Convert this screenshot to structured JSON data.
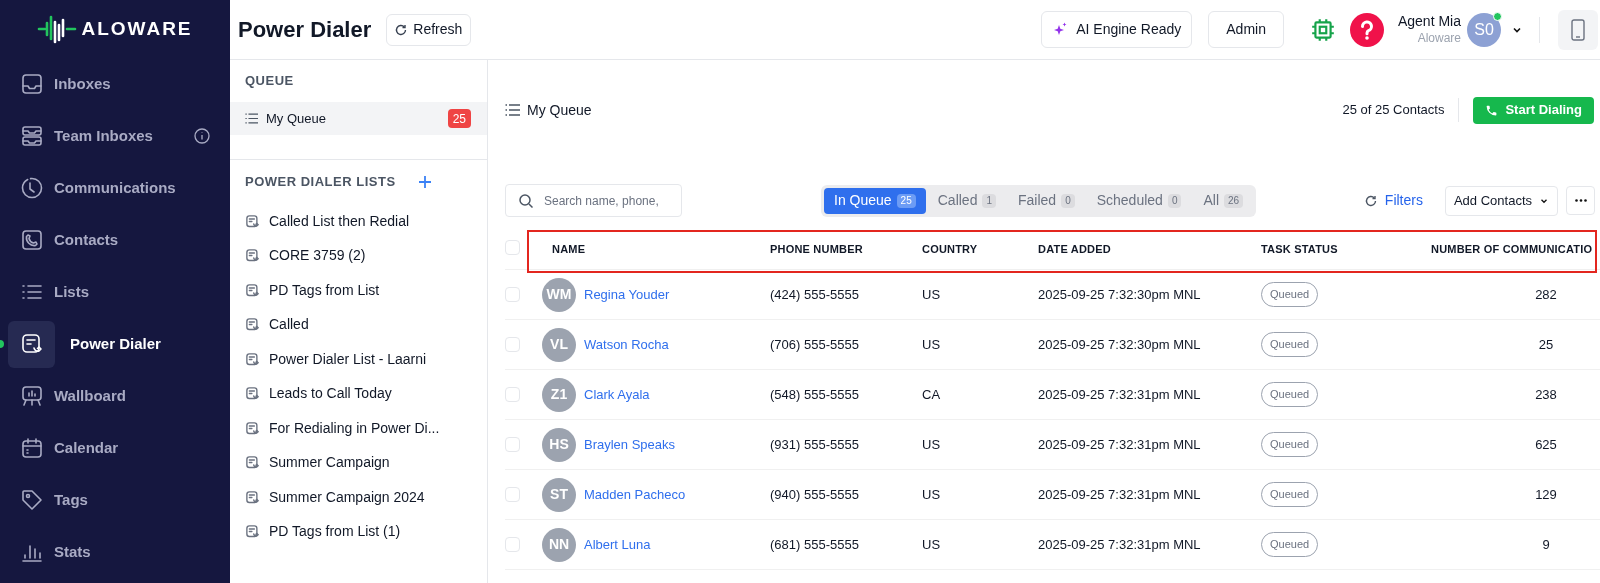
{
  "brand": {
    "name": "ALOWARE"
  },
  "sidebar": {
    "items": [
      {
        "label": "Inboxes",
        "selected": false,
        "info": false
      },
      {
        "label": "Team Inboxes",
        "selected": false,
        "info": true
      },
      {
        "label": "Communications",
        "selected": false,
        "info": false
      },
      {
        "label": "Contacts",
        "selected": false,
        "info": false
      },
      {
        "label": "Lists",
        "selected": false,
        "info": false
      },
      {
        "label": "Power Dialer",
        "selected": true,
        "info": false
      },
      {
        "label": "Wallboard",
        "selected": false,
        "info": false
      },
      {
        "label": "Calendar",
        "selected": false,
        "info": false
      },
      {
        "label": "Tags",
        "selected": false,
        "info": false
      },
      {
        "label": "Stats",
        "selected": false,
        "info": false
      }
    ]
  },
  "header": {
    "title": "Power Dialer",
    "refresh": "Refresh",
    "ai_status": "AI Engine Ready",
    "role": "Admin",
    "user": {
      "name": "Agent Mia",
      "company": "Aloware",
      "initials": "S0",
      "online": true
    }
  },
  "queue_panel": {
    "queue_heading": "QUEUE",
    "queues": [
      {
        "label": "My Queue",
        "count": "25",
        "selected": true
      }
    ],
    "lists_heading": "POWER DIALER LISTS",
    "lists": [
      {
        "label": "Called List then Redial",
        "selected": false
      },
      {
        "label": "CORE 3759 (2)",
        "selected": false
      },
      {
        "label": "PD Tags from List",
        "selected": false
      },
      {
        "label": "Called",
        "selected": false
      },
      {
        "label": "Power Dialer List - Laarni",
        "selected": false
      },
      {
        "label": "Leads to Call Today",
        "selected": false
      },
      {
        "label": "For Redialing in Power Di...",
        "selected": false
      },
      {
        "label": "Summer Campaign",
        "selected": false
      },
      {
        "label": "Summer Campaign 2024",
        "selected": false
      },
      {
        "label": "PD Tags from List (1)",
        "selected": false
      }
    ]
  },
  "main": {
    "title": "My Queue",
    "contacts_count": "25 of 25 Contacts",
    "start_button": "Start Dialing",
    "search": {
      "placeholder": "Search name, phone,"
    },
    "tabs": [
      {
        "label": "In Queue",
        "count": "25",
        "selected": true
      },
      {
        "label": "Called",
        "count": "1",
        "selected": false
      },
      {
        "label": "Failed",
        "count": "0",
        "selected": false
      },
      {
        "label": "Scheduled",
        "count": "0",
        "selected": false
      },
      {
        "label": "All",
        "count": "26",
        "selected": false
      }
    ],
    "filters": "Filters",
    "add_contacts": "Add Contacts",
    "table": {
      "header_highlighted": true,
      "all_checked": false,
      "columns": [
        "NAME",
        "PHONE NUMBER",
        "COUNTRY",
        "DATE ADDED",
        "TASK STATUS",
        "NUMBER OF COMMUNICATIO"
      ],
      "rows": [
        {
          "checked": false,
          "initials": "WM",
          "name": "Regina Youder",
          "phone": "(424) 555-5555",
          "country": "US",
          "date_added": "2025-09-25 7:32:30pm MNL",
          "status": "Queued",
          "communications": "282"
        },
        {
          "checked": false,
          "initials": "VL",
          "name": "Watson Rocha",
          "phone": "(706) 555-5555",
          "country": "US",
          "date_added": "2025-09-25 7:32:30pm MNL",
          "status": "Queued",
          "communications": "25"
        },
        {
          "checked": false,
          "initials": "Z1",
          "name": "Clark Ayala",
          "phone": "(548) 555-5555",
          "country": "CA",
          "date_added": "2025-09-25 7:32:31pm MNL",
          "status": "Queued",
          "communications": "238"
        },
        {
          "checked": false,
          "initials": "HS",
          "name": "Braylen Speaks",
          "phone": "(931) 555-5555",
          "country": "US",
          "date_added": "2025-09-25 7:32:31pm MNL",
          "status": "Queued",
          "communications": "625"
        },
        {
          "checked": false,
          "initials": "ST",
          "name": "Madden Pacheco",
          "phone": "(940) 555-5555",
          "country": "US",
          "date_added": "2025-09-25 7:32:31pm MNL",
          "status": "Queued",
          "communications": "129"
        },
        {
          "checked": false,
          "initials": "NN",
          "name": "Albert Luna",
          "phone": "(681) 555-5555",
          "country": "US",
          "date_added": "2025-09-25 7:32:31pm MNL",
          "status": "Queued",
          "communications": "9"
        }
      ]
    }
  }
}
